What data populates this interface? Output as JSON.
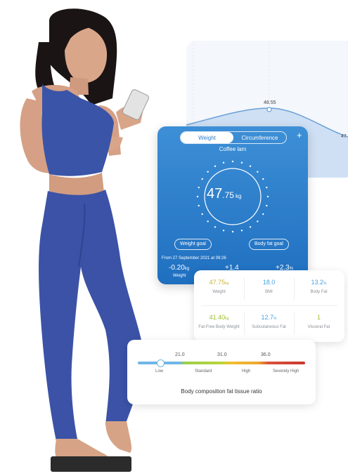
{
  "trend": {
    "peak_label": "48.55",
    "edge_label": "47",
    "line_color": "#6a9fd8",
    "fill_color": "#cfe0f4"
  },
  "weight_card": {
    "tabs": [
      "Weight",
      "Circumference"
    ],
    "active_tab": "Weight",
    "add_icon": "plus-icon",
    "user_name": "Coffee lam",
    "weight_int": "47",
    "weight_dec": ".75",
    "weight_unit": "kg",
    "weight_goal_label": "Weight goal",
    "body_fat_goal_label": "Body fat goal",
    "since": "From 27 September 2021 at 09:26",
    "changes": [
      {
        "value": "-0.20",
        "unit": "kg",
        "label": "Weight"
      },
      {
        "value": "+1.4",
        "unit": "",
        "label": ""
      },
      {
        "value": "+2.3",
        "unit": "%",
        "label": ""
      }
    ],
    "accent": "#2f7cc9"
  },
  "metrics": [
    {
      "value": "47.75",
      "unit": "kg",
      "label": "Weight",
      "color": "#c9b534"
    },
    {
      "value": "18.0",
      "unit": "",
      "label": "BMI",
      "color": "#4aa3df"
    },
    {
      "value": "13.2",
      "unit": "%",
      "label": "Body Fat",
      "color": "#4aa3df"
    },
    {
      "value": "41.40",
      "unit": "kg",
      "label": "Fat-Free Body Weight",
      "color": "#9bbf2a"
    },
    {
      "value": "12.7",
      "unit": "%",
      "label": "Subcutaneous Fat",
      "color": "#4aa3df"
    },
    {
      "value": "1",
      "unit": "",
      "label": "Visceral Fat",
      "color": "#9bbf2a"
    }
  ],
  "ratio": {
    "ticks": [
      "21.0",
      "31.0",
      "36.0"
    ],
    "zones": [
      "Low",
      "Standard",
      "High",
      "Severely High"
    ],
    "title": "Body composition fat tissue ratio"
  }
}
